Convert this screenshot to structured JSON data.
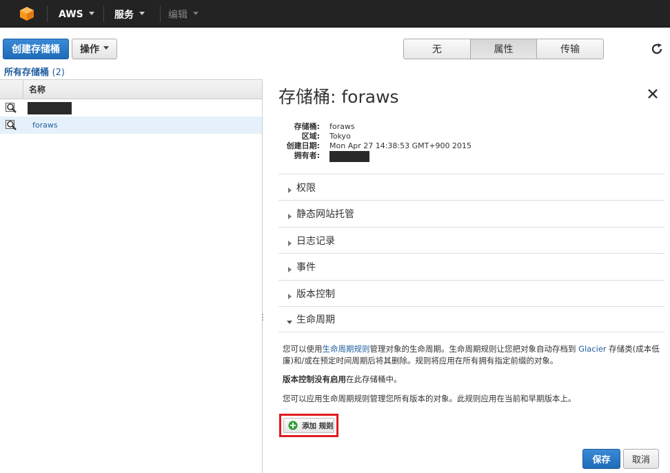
{
  "topbar": {
    "logo_icon": "aws-cube-icon",
    "aws": "AWS",
    "services": "服务",
    "edit": "编辑"
  },
  "toolbar": {
    "create_bucket": "创建存储桶",
    "actions": "操作",
    "segments": [
      "无",
      "属性",
      "传输"
    ],
    "active_segment": "属性"
  },
  "breadcrumb": {
    "label": "所有存储桶",
    "count": "(2)"
  },
  "bucket_list": {
    "header": "名称",
    "rows": [
      {
        "name": "",
        "masked": true,
        "selected": false
      },
      {
        "name": "foraws",
        "masked": false,
        "selected": true
      }
    ]
  },
  "details": {
    "title": "存储桶: foraws",
    "properties": [
      {
        "key": "存储桶:",
        "value": "foraws"
      },
      {
        "key": "区域:",
        "value": "Tokyo"
      },
      {
        "key": "创建日期:",
        "value": "Mon Apr 27 14:38:53 GMT+900 2015"
      },
      {
        "key": "拥有者:",
        "value": "",
        "masked": true
      }
    ],
    "sections": [
      "权限",
      "静态网站托管",
      "日志记录",
      "事件",
      "版本控制",
      "生命周期"
    ],
    "lifecycle": {
      "p1_a": "您可以使用",
      "p1_link1": "生命周期规则",
      "p1_b": "管理对象的生命周期。生命周期规则让您把对象自动存档到",
      "p1_link2": "Glacier",
      "p1_c": "存储类(成本低廉)和/或在预定时间周期后将其删除。规则将应用在所有拥有指定前缀的对象。",
      "p2_bold": "版本控制没有启用",
      "p2_rest": "在此存储桶中。",
      "p3": "您可以应用生命周期规则管理您所有版本的对象。此规则应用在当前和早期版本上。",
      "add_rule": "添加 规则"
    },
    "save": "保存",
    "cancel": "取消"
  },
  "colors": {
    "accent": "#1f6bb8",
    "topbar": "#232323",
    "highlight": "#e0191f",
    "selected_row": "#e5f0fa"
  }
}
